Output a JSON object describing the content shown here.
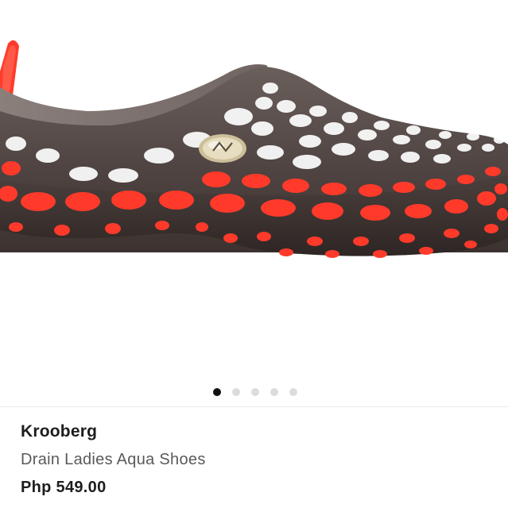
{
  "product": {
    "brand": "Krooberg",
    "name": "Drain Ladies Aqua Shoes",
    "price": "Php 549.00",
    "image": {
      "subject": "shoe-image",
      "body_color": "#5e5250",
      "accent_color": "#ff3a2a"
    }
  },
  "carousel": {
    "total_slides": 5,
    "active_index": 0,
    "colors": {
      "active": "#111111",
      "inactive": "#dcdcdc"
    }
  }
}
